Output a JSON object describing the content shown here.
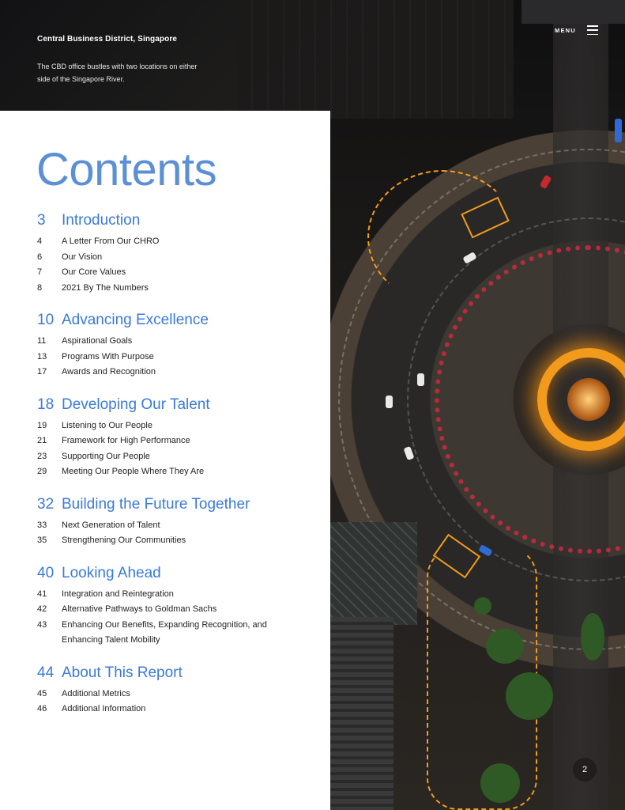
{
  "header": {
    "location_title": "Central Business District, Singapore",
    "location_description": "The CBD office bustles with two locations on either side of the Singapore River.",
    "menu_label": "MENU"
  },
  "contents": {
    "title": "Contents",
    "sections": [
      {
        "page": "3",
        "title": "Introduction",
        "entries": [
          {
            "page": "4",
            "title": "A Letter From Our CHRO"
          },
          {
            "page": "6",
            "title": "Our Vision"
          },
          {
            "page": "7",
            "title": "Our Core Values"
          },
          {
            "page": "8",
            "title": "2021 By The Numbers"
          }
        ]
      },
      {
        "page": "10",
        "title": "Advancing Excellence",
        "entries": [
          {
            "page": "11",
            "title": "Aspirational Goals"
          },
          {
            "page": "13",
            "title": "Programs With Purpose"
          },
          {
            "page": "17",
            "title": "Awards and Recognition"
          }
        ]
      },
      {
        "page": "18",
        "title": "Developing Our Talent",
        "entries": [
          {
            "page": "19",
            "title": "Listening to Our People"
          },
          {
            "page": "21",
            "title": "Framework for High Performance"
          },
          {
            "page": "23",
            "title": "Supporting Our People"
          },
          {
            "page": "29",
            "title": "Meeting Our People Where They Are"
          }
        ]
      },
      {
        "page": "32",
        "title": "Building the Future Together",
        "entries": [
          {
            "page": "33",
            "title": "Next Generation of Talent"
          },
          {
            "page": "35",
            "title": "Strengthening Our Communities"
          }
        ]
      },
      {
        "page": "40",
        "title": "Looking Ahead",
        "entries": [
          {
            "page": "41",
            "title": "Integration and Reintegration"
          },
          {
            "page": "42",
            "title": "Alternative Pathways to Goldman Sachs"
          },
          {
            "page": "43",
            "title": "Enhancing Our Benefits, Expanding Recognition, and Enhancing Talent Mobility"
          }
        ]
      },
      {
        "page": "44",
        "title": "About This Report",
        "entries": [
          {
            "page": "45",
            "title": "Additional Metrics"
          },
          {
            "page": "46",
            "title": "Additional Information"
          }
        ]
      }
    ]
  },
  "footer": {
    "page_number": "2"
  },
  "colors": {
    "accent_blue": "#3b7ad8",
    "title_blue": "#5b8fd6",
    "route_orange": "#f39b1b"
  },
  "icons": {
    "menu": "hamburger-menu-icon"
  }
}
